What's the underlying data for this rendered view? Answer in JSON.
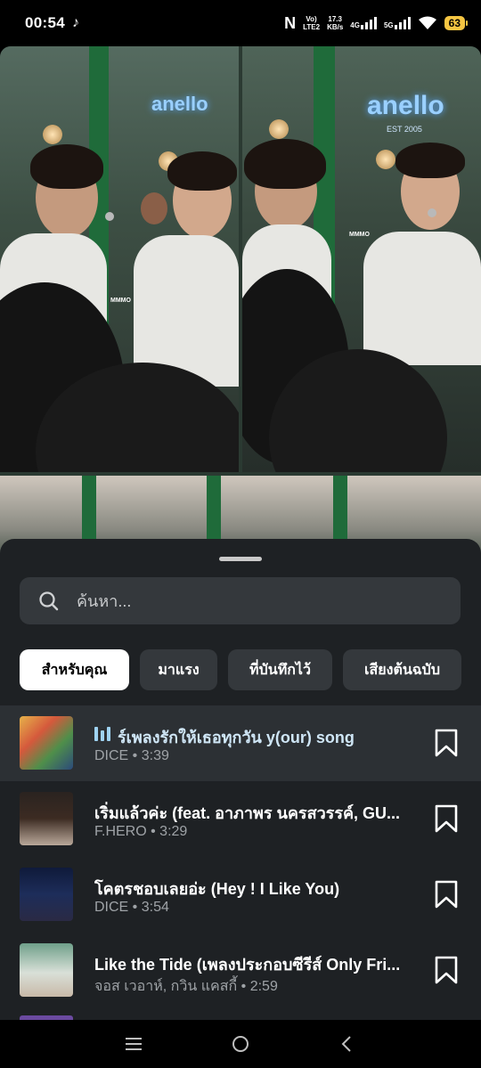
{
  "status_bar": {
    "time": "00:54",
    "tiktok_glyph": "♪",
    "nfc": "N",
    "volte_top": "Vo)",
    "volte_bottom": "LTE2",
    "speed_top": "17.3",
    "speed_bottom": "KB/s",
    "net1": "4G",
    "net2": "5G",
    "battery": "63",
    "icons": [
      "tiktok-icon",
      "nfc-icon",
      "signal-icon",
      "wifi-icon",
      "battery-icon"
    ]
  },
  "photo": {
    "sign_text": "anello",
    "est_text": "EST 2005",
    "watermark": "MMMO"
  },
  "search": {
    "placeholder": "ค้นหา..."
  },
  "tabs": [
    {
      "label": "สำหรับคุณ",
      "active": true
    },
    {
      "label": "มาแรง",
      "active": false
    },
    {
      "label": "ที่บันทึกไว้",
      "active": false
    },
    {
      "label": "เสียงต้นฉบับ",
      "active": false
    }
  ],
  "tracks": [
    {
      "title": "ร์เพลงรักให้เธอทุกวัน y(our) song",
      "artist": "DICE",
      "duration": "3:39",
      "meta": "DICE • 3:39",
      "playing": true
    },
    {
      "title": "เริ่มแล้วค่ะ (feat. อาภาพร นครสวรรค์, GU...",
      "artist": "F.HERO",
      "duration": "3:29",
      "meta": "F.HERO • 3:29",
      "playing": false
    },
    {
      "title": "โคตรชอบเลยอ่ะ (Hey ! I Like You)",
      "artist": "DICE",
      "duration": "3:54",
      "meta": "DICE • 3:54",
      "playing": false
    },
    {
      "title": "Like the Tide (เพลงประกอบซีรีส์ Only Fri...",
      "artist": "จอส เวอาห์, กวิน แคสกี้",
      "duration": "2:59",
      "meta": "จอส เวอาห์, กวิน แคสกี้ • 2:59",
      "playing": false
    }
  ],
  "colors": {
    "sheet_bg": "#1e2124",
    "field_bg": "#34383c",
    "playing_row": "#2c3034",
    "accent_playing": "#9fd3f3",
    "battery": "#f5c542"
  }
}
